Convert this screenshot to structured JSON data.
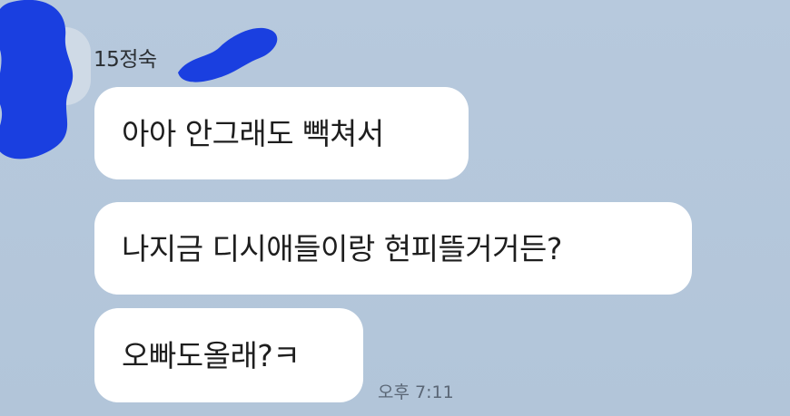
{
  "chat": {
    "sender_name": "15정숙",
    "messages": [
      {
        "text": "아아 안그래도 빽쳐서"
      },
      {
        "text": "나지금 디시애들이랑 현피뜰거거든?"
      },
      {
        "text": "오빠도올래?ㅋ"
      }
    ],
    "timestamp": "오후 7:11"
  },
  "colors": {
    "background": "#b5c8dc",
    "bubble": "#ffffff",
    "redaction": "#1a3fe0"
  }
}
